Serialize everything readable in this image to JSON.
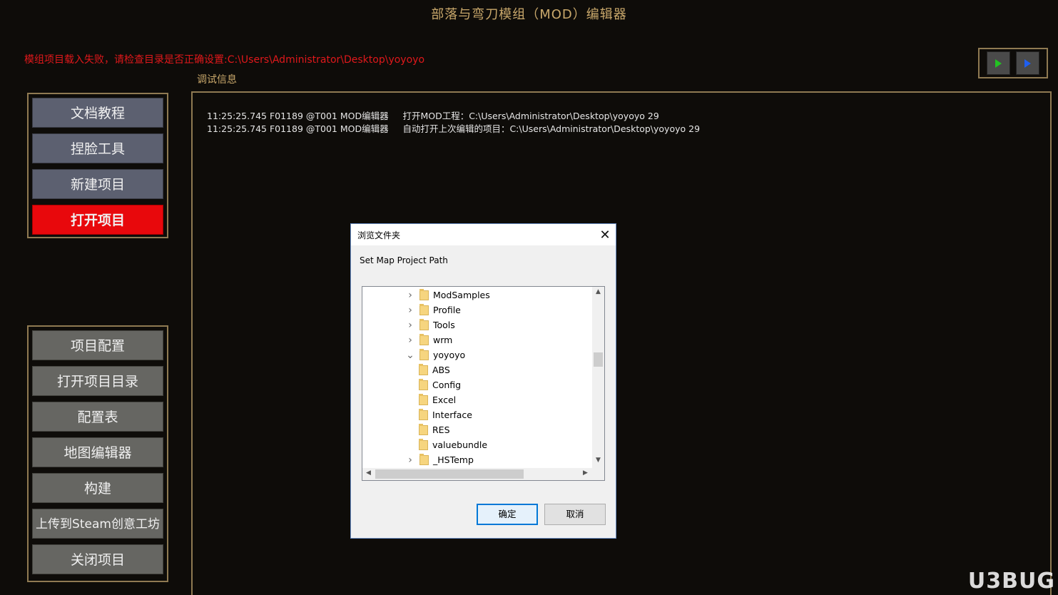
{
  "app": {
    "title": "部落与弯刀模组（MOD）编辑器",
    "error": "模组项目载入失败，请检查目录是否正确设置:C:\\Users\\Administrator\\Desktop\\yoyoyo",
    "debug_label": "调试信息"
  },
  "play_buttons": [
    {
      "icon": "play-green-icon",
      "color": "#22c322"
    },
    {
      "icon": "play-blue-icon",
      "color": "#1f5ff0"
    }
  ],
  "menu_top": [
    {
      "label": "文档教程"
    },
    {
      "label": "捏脸工具"
    },
    {
      "label": "新建项目"
    },
    {
      "label": "打开项目",
      "active": true
    }
  ],
  "menu_bottom": [
    {
      "label": "项目配置"
    },
    {
      "label": "打开项目目录"
    },
    {
      "label": "配置表"
    },
    {
      "label": "地图编辑器"
    },
    {
      "label": "构建"
    },
    {
      "label": "上传到Steam创意工坊"
    },
    {
      "label": "关闭项目"
    }
  ],
  "log": [
    "11:25:25.745 F01189 @T001 MOD编辑器     打开MOD工程：C:\\Users\\Administrator\\Desktop\\yoyoyo 29",
    "11:25:25.745 F01189 @T001 MOD编辑器     自动打开上次编辑的项目：C:\\Users\\Administrator\\Desktop\\yoyoyo 29"
  ],
  "dialog": {
    "title": "浏览文件夹",
    "prompt": "Set Map Project Path",
    "ok": "确定",
    "cancel": "取消",
    "tree": [
      {
        "name": "ModSamples",
        "level": 1,
        "expander": "collapsed"
      },
      {
        "name": "Profile",
        "level": 1,
        "expander": "collapsed"
      },
      {
        "name": "Tools",
        "level": 1,
        "expander": "collapsed"
      },
      {
        "name": "wrm",
        "level": 1,
        "expander": "collapsed"
      },
      {
        "name": "yoyoyo",
        "level": 1,
        "expander": "expanded"
      },
      {
        "name": "ABS",
        "level": 2,
        "expander": "none"
      },
      {
        "name": "Config",
        "level": 2,
        "expander": "none"
      },
      {
        "name": "Excel",
        "level": 2,
        "expander": "none"
      },
      {
        "name": "Interface",
        "level": 2,
        "expander": "none"
      },
      {
        "name": "RES",
        "level": 2,
        "expander": "none"
      },
      {
        "name": "valuebundle",
        "level": 2,
        "expander": "none"
      },
      {
        "name": "_HSTemp",
        "level": 1,
        "expander": "collapsed"
      }
    ]
  },
  "watermark": "U3BUG"
}
